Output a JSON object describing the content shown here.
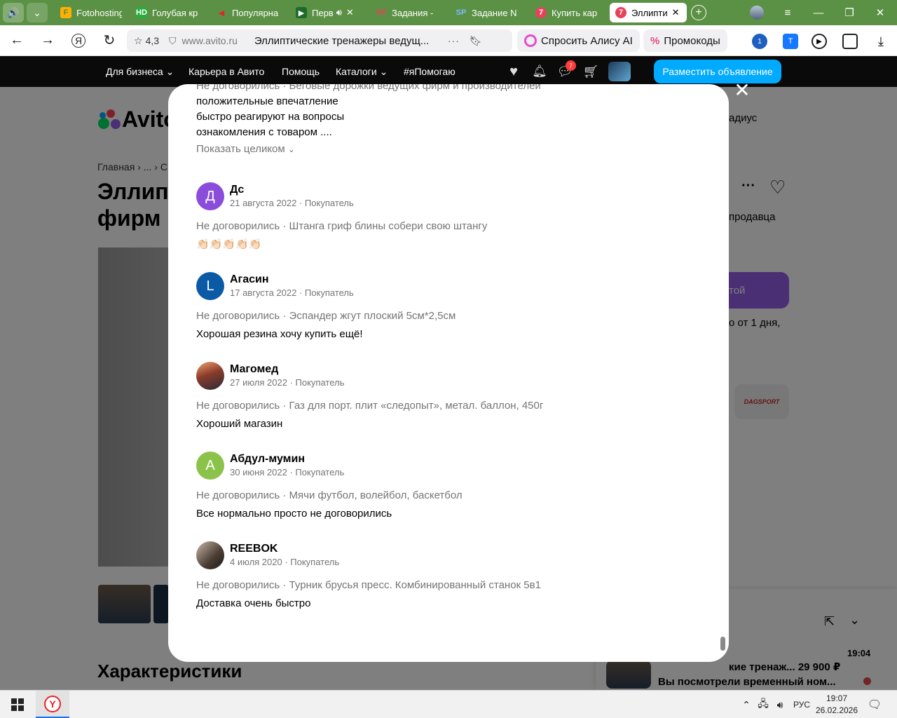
{
  "browser": {
    "tabs": [
      {
        "label": "Fotohosting",
        "favicon": "F",
        "color": "#ffb000",
        "fg": "#5b9144"
      },
      {
        "label": "Голубая кр",
        "favicon": "HD",
        "color": "#27ae3f",
        "fg": "#ffffff"
      },
      {
        "label": "Популярна",
        "favicon": "◀",
        "color": "#5b9144",
        "fg": "#e3242b"
      },
      {
        "label": "Перв",
        "favicon": "▶",
        "color": "#1c6b2d",
        "fg": "#ffffff"
      },
      {
        "label": "Задания -",
        "favicon": "SP",
        "color": "#5b9144",
        "fg": "#e8425b"
      },
      {
        "label": "Задание N",
        "favicon": "SP",
        "color": "#5b9144",
        "fg": "#7dbbff"
      },
      {
        "label": "Купить кар",
        "favicon": "7",
        "color": "#e8425b",
        "fg": "#ffffff"
      },
      {
        "label": "Эллипти",
        "favicon": "7",
        "color": "#e8425b",
        "fg": "#ffffff",
        "active": true
      }
    ],
    "rating": "4,3",
    "domain": "www.avito.ru",
    "page_title": "Эллиптические тренажеры ведущ...",
    "alice_label": "Спросить Алису AI",
    "promo_label": "Промокоды",
    "badge_count_ext": "1"
  },
  "avito_nav": {
    "items": [
      "Для бизнеса",
      "Карьера в Авито",
      "Помощь",
      "Каталоги",
      "#яПомогаю"
    ],
    "messages_badge": "7",
    "post_button": "Разместить объявление"
  },
  "page_behind": {
    "logo": "Avito",
    "breadcrumbs": "Главная › ... › С",
    "title": "Эллип фирм",
    "right_texts": {
      "radius": "адиус",
      "seller": "продавца",
      "call": "той",
      "delivery": "о от 1 дня,"
    },
    "shop_logo": "DAGSPORT",
    "chars_heading": "Характеристики",
    "chat": {
      "time": "19:04",
      "title": "кие тренаж...",
      "price": "29 900 ₽",
      "subtitle": "Вы посмотрели временный ном..."
    }
  },
  "modal": {
    "prev": {
      "deal": "Не договорились · Беговые дорожки ведущих фирм и производителей",
      "lines": [
        "положительные впечатление",
        "быстро реагируют на вопросы",
        "ознакомления с товаром ...."
      ],
      "show_more": "Показать целиком"
    },
    "reviews": [
      {
        "initial": "Д",
        "avatar_color": "#8a4ddb",
        "name": "Дс",
        "sub": "21 августа 2022 · Покупатель",
        "deal": "Не договорились · Штанга гриф блины собери свою штангу",
        "text": "👏🏻👏🏻👏🏻👏🏻👏🏻"
      },
      {
        "initial": "L",
        "avatar_color": "#0b5aa6",
        "name": "Агасин",
        "sub": "17 августа 2022 · Покупатель",
        "deal": "Не договорились · Эспандер жгут плоский 5см*2,5см",
        "text": "Хорошая резина хочу купить ещё!"
      },
      {
        "initial": "",
        "avatar_color": "#8a3b2a",
        "name": "Магомед",
        "sub": "27 июля 2022 · Покупатель",
        "deal": "Не договорились · Газ для порт. плит «следопыт», метал. баллон, 450г",
        "text": "Хороший магазин"
      },
      {
        "initial": "А",
        "avatar_color": "#8bc34a",
        "name": "Абдул-мумин",
        "sub": "30 июня 2022 · Покупатель",
        "deal": "Не договорились · Мячи футбол, волейбол, баскетбол",
        "text": "Все нормально просто не договорились"
      },
      {
        "initial": "",
        "avatar_color": "#6b5a4e",
        "name": "REEBOK",
        "sub": "4 июля 2020 · Покупатель",
        "deal": "Не договорились · Турник брусья пресс. Комбинированный станок 5в1",
        "text": "Доставка очень быстро"
      }
    ]
  },
  "taskbar": {
    "lang": "РУС",
    "time": "19:07",
    "date": "26.02.2026"
  }
}
